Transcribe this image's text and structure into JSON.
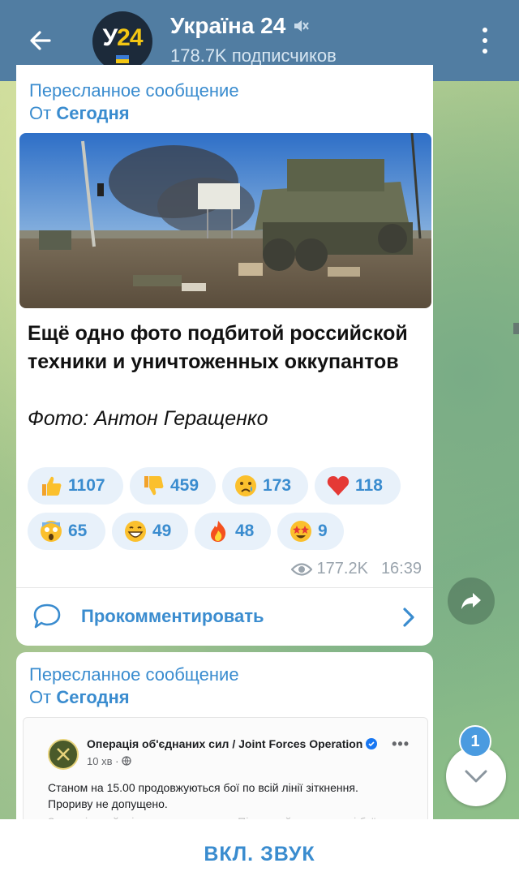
{
  "header": {
    "channel_name": "Україна 24",
    "subscribers": "178.7K подписчиков",
    "avatar_text_prefix": "У",
    "avatar_text_suffix": "24",
    "muted_icon": "muted-speaker-icon",
    "back_icon": "arrow-left-icon",
    "menu_icon": "more-vertical-icon"
  },
  "message1": {
    "forward_label": "Пересланное сообщение",
    "forward_from_prefix": "От",
    "forward_from": "Сегодня",
    "text_bold": "Ещё одно фото подбитой российской техники и уничтоженных оккупантов",
    "text_italic": "Фото: Антон Геращенко",
    "reactions": [
      {
        "emoji": "thumbs-up",
        "count": "1107"
      },
      {
        "emoji": "thumbs-down",
        "count": "459"
      },
      {
        "emoji": "crying-face",
        "count": "173"
      },
      {
        "emoji": "red-heart",
        "count": "118"
      },
      {
        "emoji": "screaming-face",
        "count": "65"
      },
      {
        "emoji": "grinning-face",
        "count": "49"
      },
      {
        "emoji": "fire",
        "count": "48"
      },
      {
        "emoji": "star-struck",
        "count": "9"
      }
    ],
    "views": "177.2K",
    "time": "16:39",
    "comment_label": "Прокомментировать"
  },
  "message2": {
    "forward_label": "Пересланное сообщение",
    "forward_from_prefix": "От",
    "forward_from": "Сегодня",
    "embed_author": "Операція об'єднаних сил / Joint Forces Operation",
    "embed_time": "10 хв ·",
    "embed_text": "Станом на 15.00 продовжуються бої по всій лінії зіткнення. Прориву не допущено.",
    "embed_text_faded": "Запеклі в районі населеного пункту Пішевих йдуть запеклі бої"
  },
  "unread_count": "1",
  "bottom_action": "ВКЛ. ЗВУК",
  "colors": {
    "header": "#517da2",
    "accent": "#3a8ccf",
    "reaction_bg": "#e8f1fa",
    "badge": "#4a9be0"
  }
}
